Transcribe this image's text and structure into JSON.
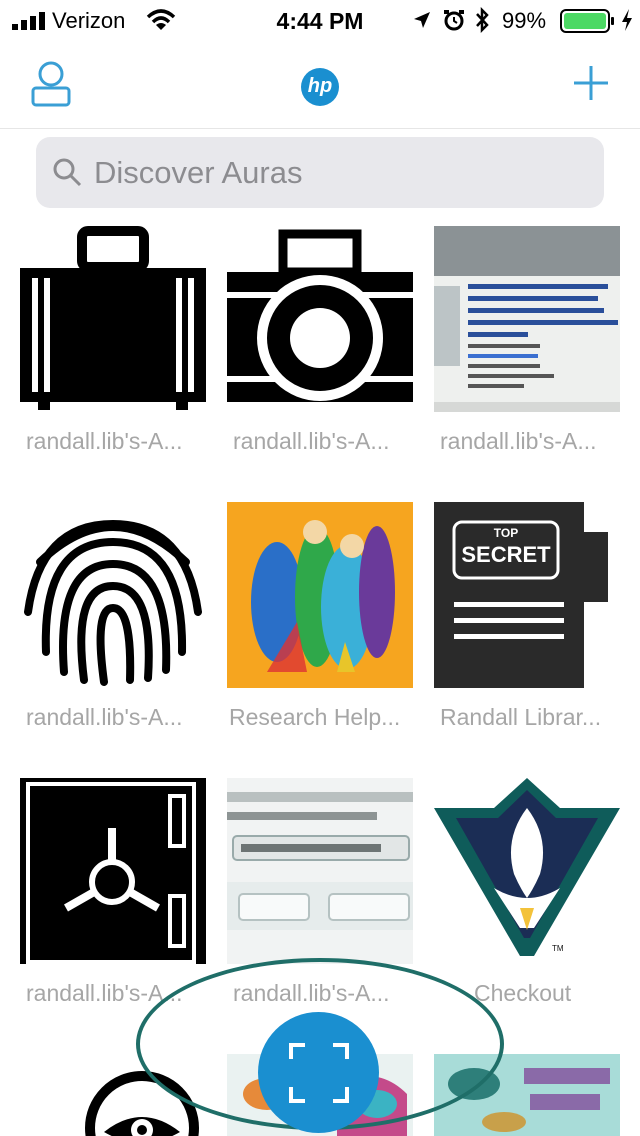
{
  "status_bar": {
    "carrier": "Verizon",
    "time": "4:44 PM",
    "battery_percent": "99%"
  },
  "header": {
    "logo_text": "hp"
  },
  "search": {
    "placeholder": "Discover Auras"
  },
  "grid": {
    "items": [
      {
        "caption": "randall.lib's-A...",
        "icon": "briefcase-icon"
      },
      {
        "caption": "randall.lib's-A...",
        "icon": "camera-icon"
      },
      {
        "caption": "randall.lib's-A...",
        "icon": "book-photo-icon"
      },
      {
        "caption": "randall.lib's-A...",
        "icon": "fingerprint-icon"
      },
      {
        "caption": "Research Help...",
        "icon": "superheroes-image"
      },
      {
        "caption": "Randall Librar...",
        "icon": "top-secret-folder-icon",
        "label_top": "TOP",
        "label_bottom": "SECRET"
      },
      {
        "caption": "randall.lib's-A...",
        "icon": "safe-icon"
      },
      {
        "caption": "randall.lib's-A...",
        "icon": "reservation-screenshot-image"
      },
      {
        "caption": "Checkout",
        "icon": "seahawk-logo",
        "mark": "TM"
      },
      {
        "caption": "",
        "icon": "eye-icon"
      },
      {
        "caption": "",
        "icon": "seas-day-image"
      },
      {
        "caption": "",
        "icon": "seas-day-image-2"
      }
    ]
  },
  "colors": {
    "accent": "#1a8fd0",
    "caption": "#a6a6a6",
    "ring": "#1f6e68"
  }
}
